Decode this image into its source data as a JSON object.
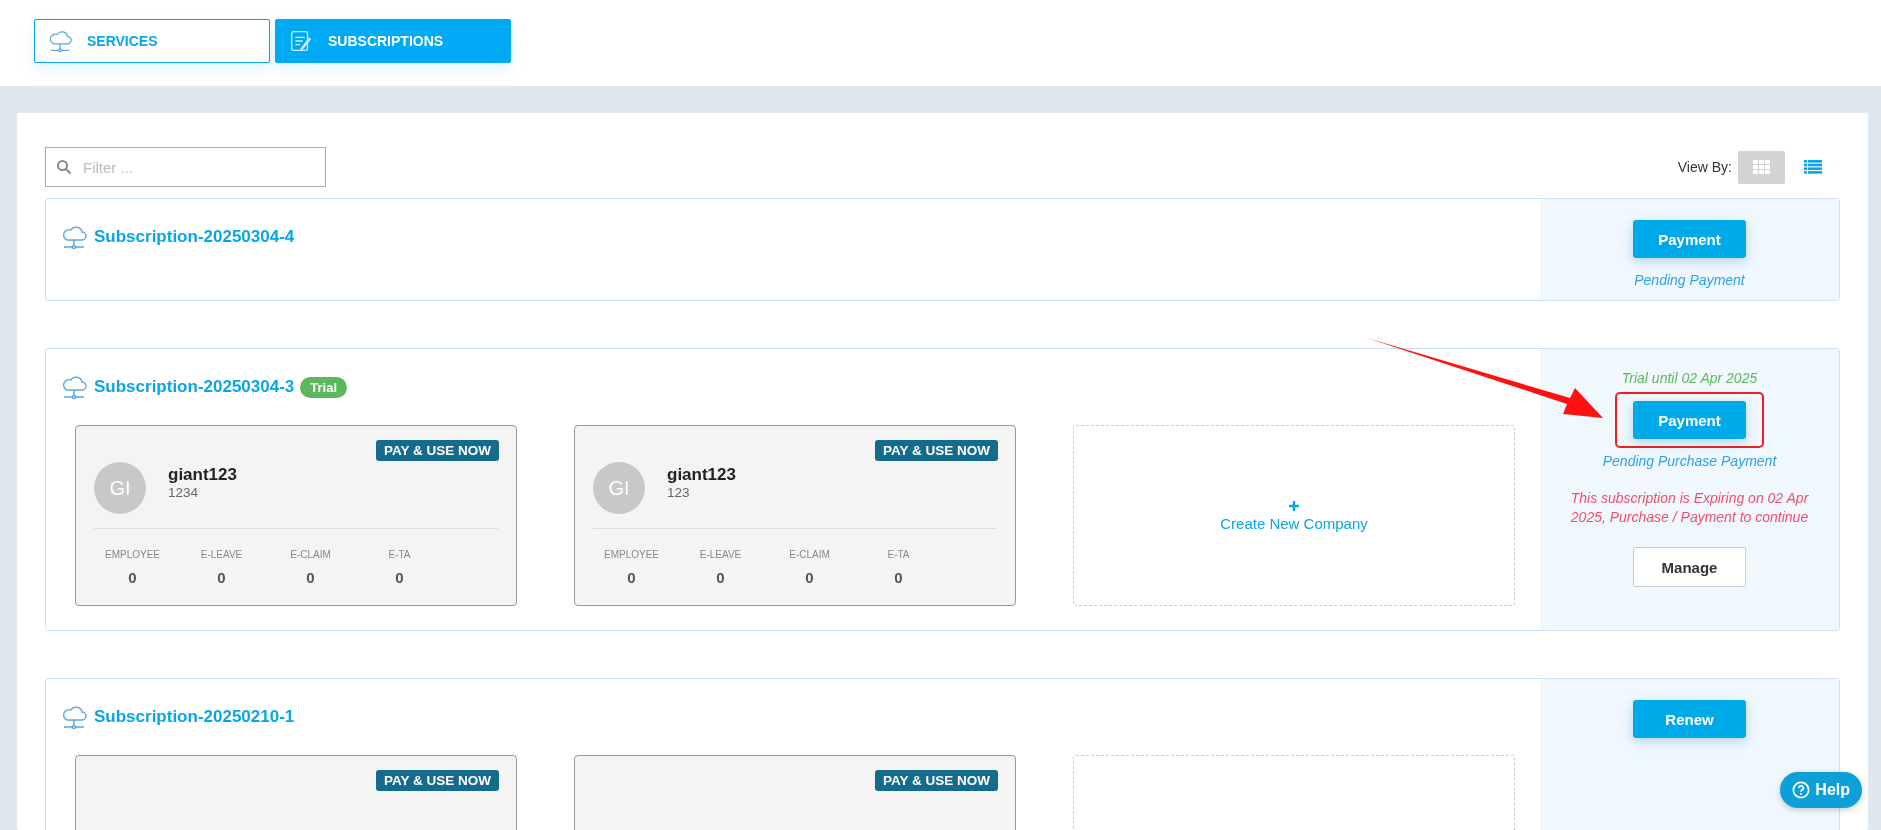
{
  "tabs": [
    {
      "label": "SERVICES",
      "kind": "cloud",
      "selected": false
    },
    {
      "label": "SUBSCRIPTIONS",
      "kind": "document",
      "selected": true
    }
  ],
  "filter": {
    "placeholder": "Filter ..."
  },
  "view_by": {
    "label": "View By:",
    "options": [
      {
        "kind": "grid",
        "selected": true
      },
      {
        "kind": "list",
        "selected": false
      }
    ]
  },
  "subscriptions": [
    {
      "name": "Subscription-20250304-4",
      "actions": [
        {
          "label": "Payment",
          "kind": "primary",
          "highlighted": false
        }
      ],
      "status": "Pending Payment"
    },
    {
      "name": "Subscription-20250304-3",
      "badge": "Trial",
      "trial_note": "Trial until 02 Apr 2025",
      "companies": [
        {
          "initials": "GI",
          "name": "giant123",
          "code": "1234",
          "badge": "PAY & USE NOW",
          "stats": [
            {
              "label": "EMPLOYEE",
              "value": "0"
            },
            {
              "label": "E-LEAVE",
              "value": "0"
            },
            {
              "label": "E-CLAIM",
              "value": "0"
            },
            {
              "label": "E-TA",
              "value": "0"
            }
          ]
        },
        {
          "initials": "GI",
          "name": "giant123",
          "code": "123",
          "badge": "PAY & USE NOW",
          "stats": [
            {
              "label": "EMPLOYEE",
              "value": "0"
            },
            {
              "label": "E-LEAVE",
              "value": "0"
            },
            {
              "label": "E-CLAIM",
              "value": "0"
            },
            {
              "label": "E-TA",
              "value": "0"
            }
          ]
        }
      ],
      "create_slot": {
        "kind": "create",
        "label": "Create New Company"
      },
      "actions": [
        {
          "label": "Payment",
          "kind": "primary",
          "highlighted": true
        }
      ],
      "status": "Pending Purchase Payment",
      "warning": "This subscription is Expiring on 02 Apr 2025, Purchase / Payment to continue",
      "secondary_actions": [
        {
          "label": "Manage"
        }
      ]
    },
    {
      "name": "Subscription-20250210-1",
      "companies": [
        {
          "badge": "PAY & USE NOW"
        },
        {
          "badge": "PAY & USE NOW"
        }
      ],
      "create_slot": {
        "kind": "empty"
      },
      "actions": [
        {
          "label": "Renew",
          "kind": "primary",
          "highlighted": false
        }
      ]
    }
  ],
  "help": {
    "label": "Help"
  }
}
